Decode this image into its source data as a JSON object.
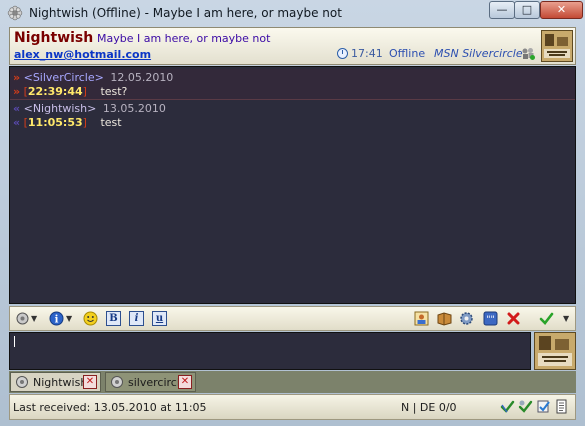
{
  "window": {
    "title": "Nightwish (Offline) - Maybe I am here, or maybe not",
    "buttons": {
      "minimize": "—",
      "maximize": "□",
      "close": "✕"
    }
  },
  "header": {
    "nick": "Nightwish",
    "status_message": "Maybe I am here, or maybe not",
    "email": "alex_nw@hotmail.com",
    "time": "17:41",
    "status": "Offline",
    "protocol": "MSN Silvercircle"
  },
  "messages": [
    {
      "direction": "in",
      "nick": "<SilverCircle>",
      "date": "12.05.2010",
      "time": "22:39:44",
      "text": "test?"
    },
    {
      "direction": "out",
      "nick": "<Nightwish>",
      "date": "13.05.2010",
      "time": "11:05:53",
      "text": "test"
    }
  ],
  "toolbar": {
    "bold": "B",
    "italic": "i",
    "underline": "u"
  },
  "tabs": [
    {
      "label": "Nightwish",
      "active": true
    },
    {
      "label": "silvercircle",
      "active": false
    }
  ],
  "statusbar": {
    "last_received": "Last received: 13.05.2010 at 11:05",
    "encoding": "N | DE 0/0"
  },
  "colors": {
    "log_bg": "#2c2c3c",
    "accent_red": "#d23d1a",
    "timestamp": "#ffe86a",
    "nick_header": "#7a0000",
    "link": "#0b36c6"
  }
}
